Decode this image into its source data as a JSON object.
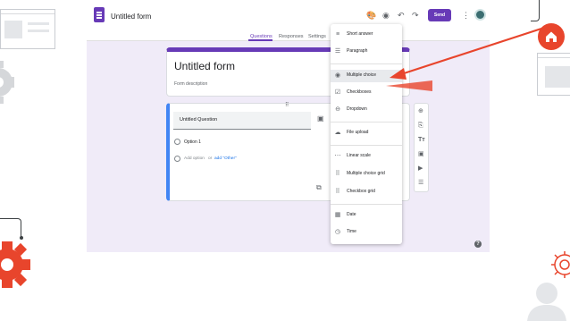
{
  "app": {
    "title": "Untitled form",
    "send_label": "Send",
    "tabs": [
      {
        "label": "Questions",
        "active": true
      },
      {
        "label": "Responses",
        "active": false
      },
      {
        "label": "Settings",
        "active": false
      }
    ]
  },
  "form": {
    "title": "Untitled form",
    "description_placeholder": "Form description"
  },
  "question": {
    "title": "Untitled Question",
    "option_1": "Option 1",
    "add_option": "Add option",
    "or": "or",
    "add_other": "add \"Other\""
  },
  "type_menu": {
    "items": [
      {
        "label": "Short answer",
        "icon": "short-answer-icon"
      },
      {
        "label": "Paragraph",
        "icon": "paragraph-icon"
      },
      {
        "label": "Multiple choice",
        "icon": "radio-icon",
        "selected": true
      },
      {
        "label": "Checkboxes",
        "icon": "checkbox-icon"
      },
      {
        "label": "Dropdown",
        "icon": "dropdown-icon"
      },
      {
        "label": "File upload",
        "icon": "cloud-upload-icon"
      },
      {
        "label": "Linear scale",
        "icon": "linear-scale-icon"
      },
      {
        "label": "Multiple choice grid",
        "icon": "grid-icon"
      },
      {
        "label": "Checkbox grid",
        "icon": "grid-icon"
      },
      {
        "label": "Date",
        "icon": "calendar-icon"
      },
      {
        "label": "Time",
        "icon": "clock-icon"
      }
    ]
  },
  "colors": {
    "accent": "#673ab7",
    "canvas": "#f0ebf8",
    "arrow": "#e8452c",
    "active_border": "#4285f4"
  }
}
